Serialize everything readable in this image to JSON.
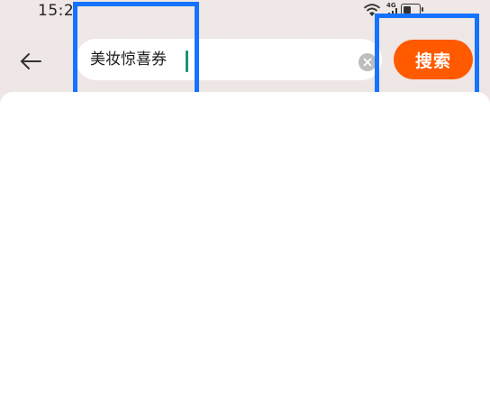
{
  "status_bar": {
    "time": "15:2",
    "icons": [
      "wifi-icon",
      "signal-4g-icon",
      "battery-icon"
    ],
    "network_tag": "4G",
    "battery_level": 0.55
  },
  "header": {
    "back_icon": "arrow-left-icon",
    "search": {
      "value": "美妆惊喜券",
      "clear_icon": "close-circle-icon"
    },
    "search_button_label": "搜索"
  },
  "colors": {
    "accent": "#ff5a00",
    "highlight": "#1573ff",
    "caret": "#1e8f7a",
    "header_bg": "#ece4e2",
    "content_bg": "#ffffff"
  }
}
